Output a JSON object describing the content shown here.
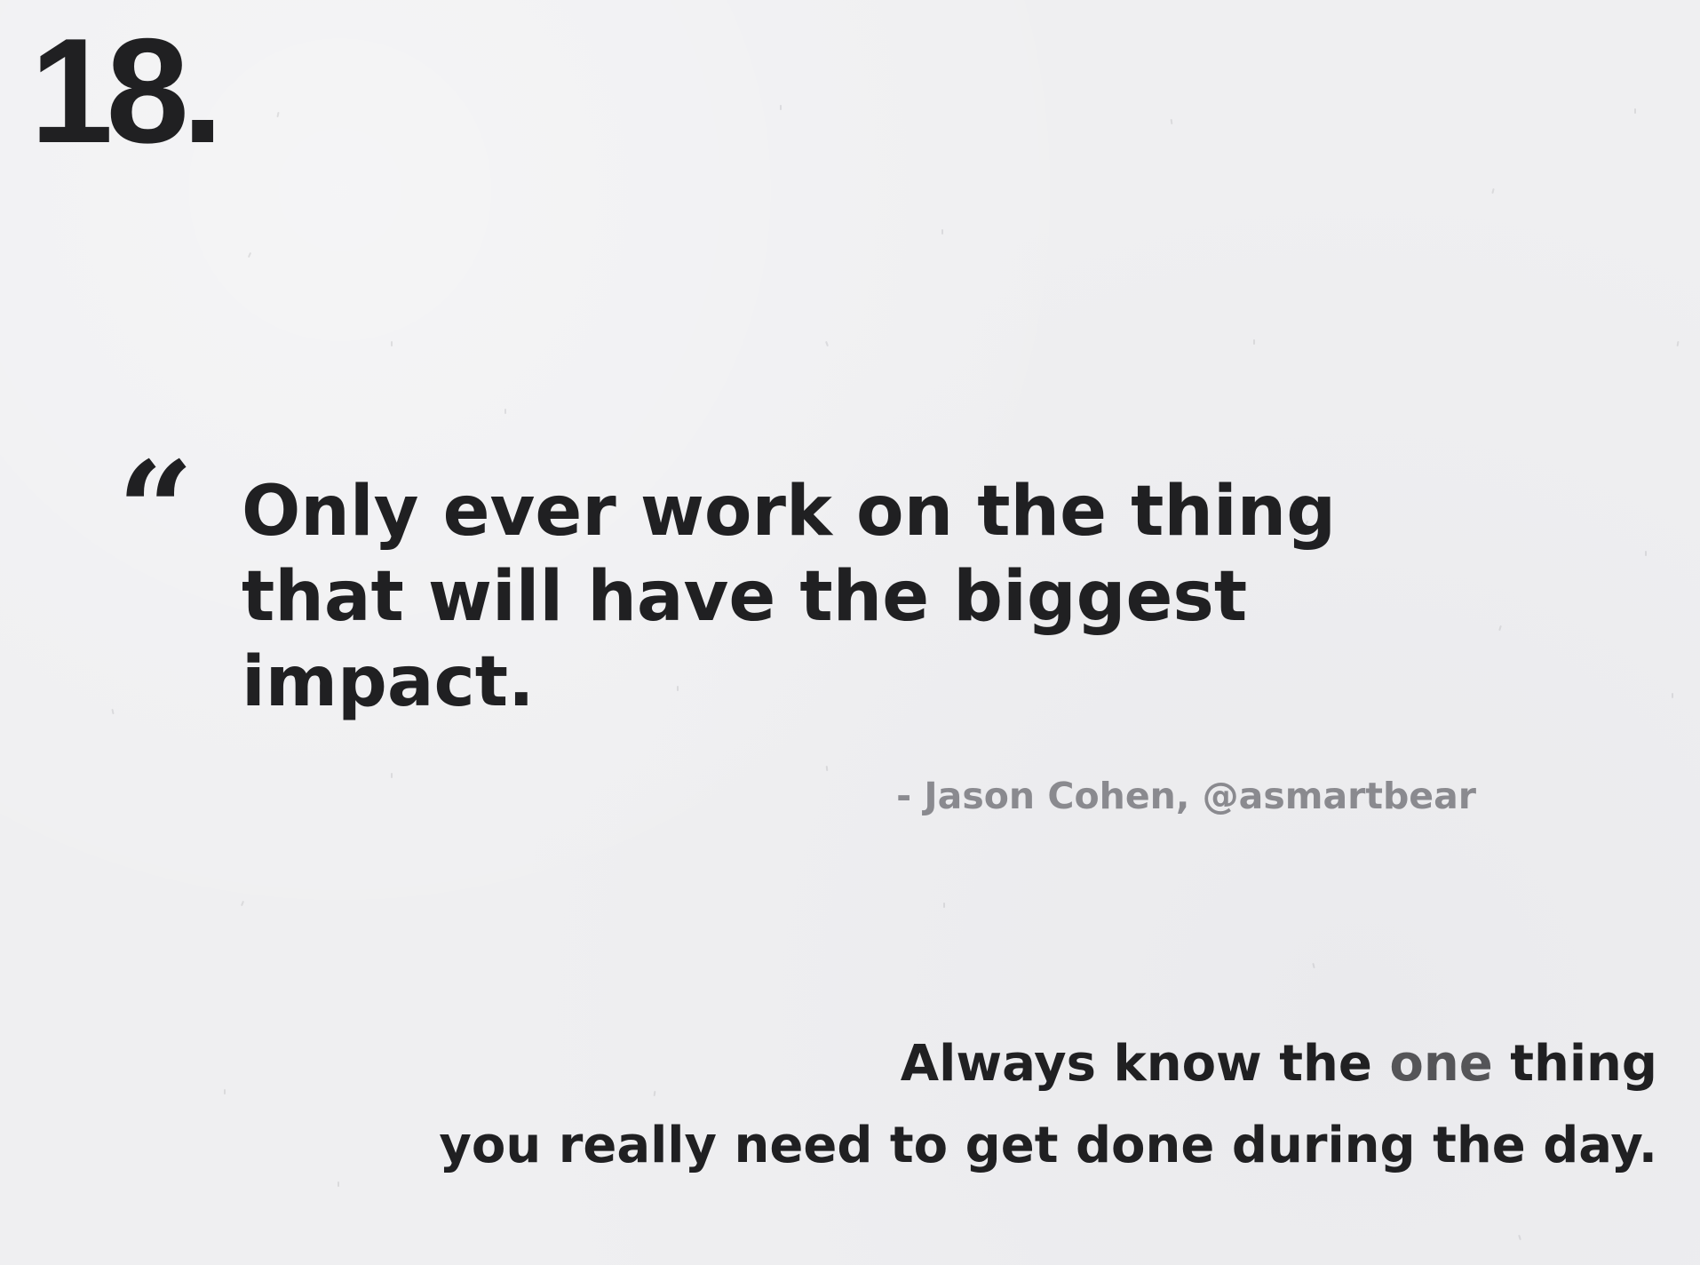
{
  "slide": {
    "number": "18."
  },
  "quote": {
    "mark": "“",
    "lines": [
      "Only ever work on the thing",
      "that will have the biggest",
      "impact."
    ],
    "attribution": "- Jason Cohen, @asmartbear"
  },
  "takeaway": {
    "line1_before": "Always know the ",
    "line1_highlight": "one",
    "line1_after": " thing",
    "line2": "you really need to get done during the day."
  },
  "colors": {
    "background": "#efeff1",
    "text": "#202022",
    "attribution": "#8a8a8f",
    "highlight": "#555558"
  }
}
